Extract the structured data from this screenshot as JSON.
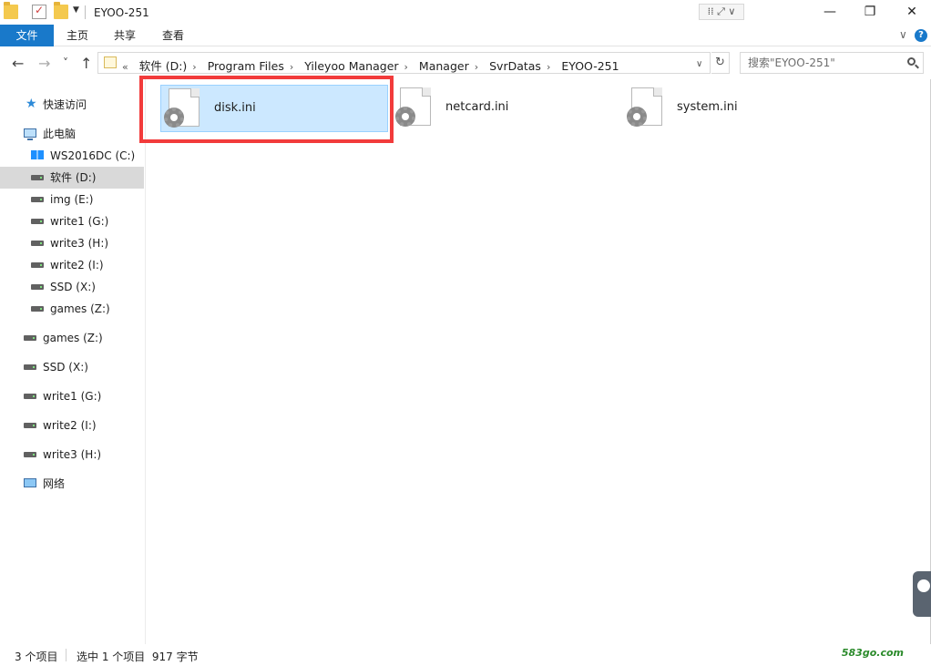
{
  "window": {
    "title": "EYOO-251",
    "controls": {
      "minimize": "—",
      "maximize": "❐",
      "close": "✕"
    },
    "title_stub": "⁞⁞ ⤢ ∨"
  },
  "ribbon": {
    "tabs": [
      "文件",
      "主页",
      "共享",
      "查看"
    ],
    "expand": "∨",
    "help": "?"
  },
  "nav": {
    "back": "←",
    "forward": "→",
    "recent": "˅",
    "up": "↑",
    "breadcrumb_overflow": "«",
    "breadcrumbs": [
      "软件 (D:)",
      "Program Files",
      "Yileyoo Manager",
      "Manager",
      "SvrDatas",
      "EYOO-251"
    ],
    "separator": "›",
    "address_dropdown": "∨",
    "refresh": "↻",
    "search_placeholder": "搜索\"EYOO-251\""
  },
  "sidebar": {
    "items": [
      {
        "label": "快速访问",
        "icon": "star-icon"
      },
      {
        "label": "此电脑",
        "icon": "pc-icon"
      },
      {
        "label": "WS2016DC (C:)",
        "icon": "windows-drive-icon"
      },
      {
        "label": "软件 (D:)",
        "icon": "drive-icon",
        "selected": true
      },
      {
        "label": "img (E:)",
        "icon": "drive-icon"
      },
      {
        "label": "write1 (G:)",
        "icon": "drive-icon"
      },
      {
        "label": "write3 (H:)",
        "icon": "drive-icon"
      },
      {
        "label": "write2 (I:)",
        "icon": "drive-icon"
      },
      {
        "label": "SSD (X:)",
        "icon": "drive-icon"
      },
      {
        "label": "games (Z:)",
        "icon": "drive-icon"
      },
      {
        "label": "games (Z:)",
        "icon": "drive-icon"
      },
      {
        "label": "SSD (X:)",
        "icon": "drive-icon"
      },
      {
        "label": "write1 (G:)",
        "icon": "drive-icon"
      },
      {
        "label": "write2 (I:)",
        "icon": "drive-icon"
      },
      {
        "label": "write3 (H:)",
        "icon": "drive-icon"
      },
      {
        "label": "网络",
        "icon": "network-icon"
      }
    ]
  },
  "files": [
    {
      "name": "disk.ini",
      "icon": "ini-settings-file-icon",
      "selected": true
    },
    {
      "name": "netcard.ini",
      "icon": "ini-settings-file-icon"
    },
    {
      "name": "system.ini",
      "icon": "ini-settings-file-icon"
    }
  ],
  "status": {
    "item_count": "3 个项目",
    "selection": "选中 1 个项目  917 字节"
  },
  "watermark": "583go.com",
  "colors": {
    "accent": "#1979ca",
    "selection": "#cce8ff",
    "highlight_box": "#f23b3b"
  }
}
